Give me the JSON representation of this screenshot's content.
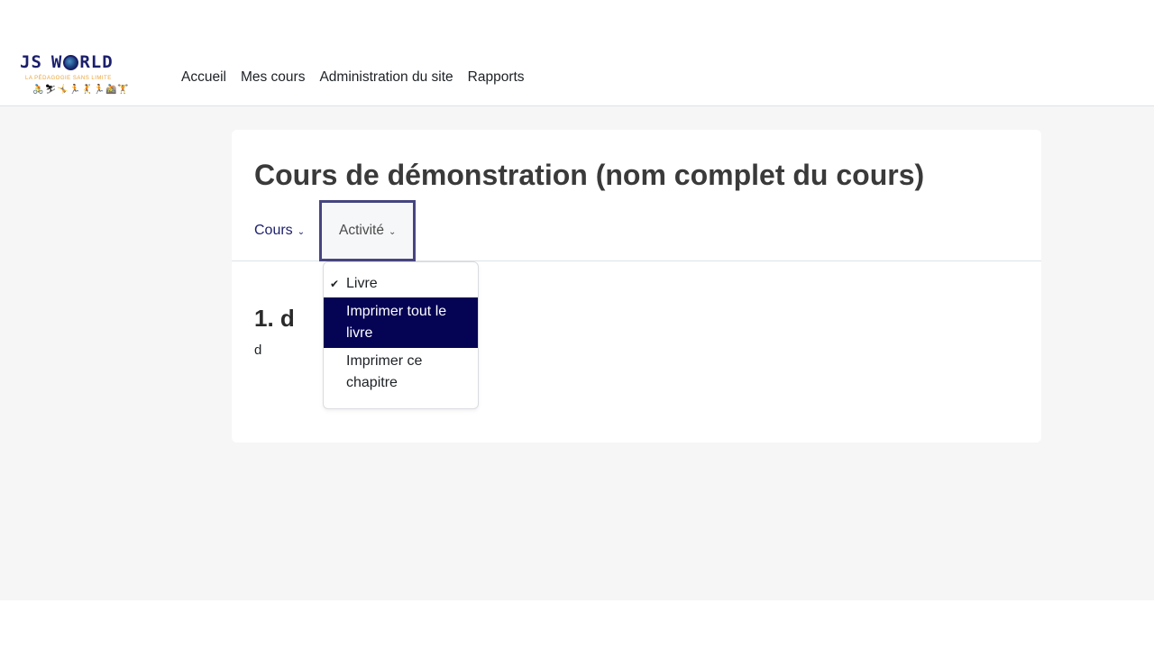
{
  "logo": {
    "word_left": "JS",
    "word_right": "RLD",
    "word_mid": "W",
    "tagline": "LA PÉDAGOGIE SANS LIMITE",
    "figures": "🚴⛷🤸🏃🤾🏃🚵🏋"
  },
  "primary_nav": {
    "items": [
      {
        "label": "Accueil"
      },
      {
        "label": "Mes cours"
      },
      {
        "label": "Administration du site"
      },
      {
        "label": "Rapports"
      }
    ]
  },
  "course": {
    "title": "Cours de démonstration (nom complet du cours)"
  },
  "secondary_nav": {
    "cours_label": "Cours",
    "activite_label": "Activité"
  },
  "section": {
    "heading": "1. d",
    "text": "d"
  },
  "dropdown": {
    "items": [
      {
        "label": "Livre",
        "checked": true
      },
      {
        "label": "Imprimer tout le livre",
        "active": true
      },
      {
        "label": "Imprimer ce chapitre"
      }
    ]
  },
  "colors": {
    "active_item_bg": "#050354",
    "brand_navy": "#1b1f6b",
    "focus_border": "#474580"
  },
  "icons": {
    "chevron": "chevron-down-icon",
    "check": "check-icon"
  }
}
